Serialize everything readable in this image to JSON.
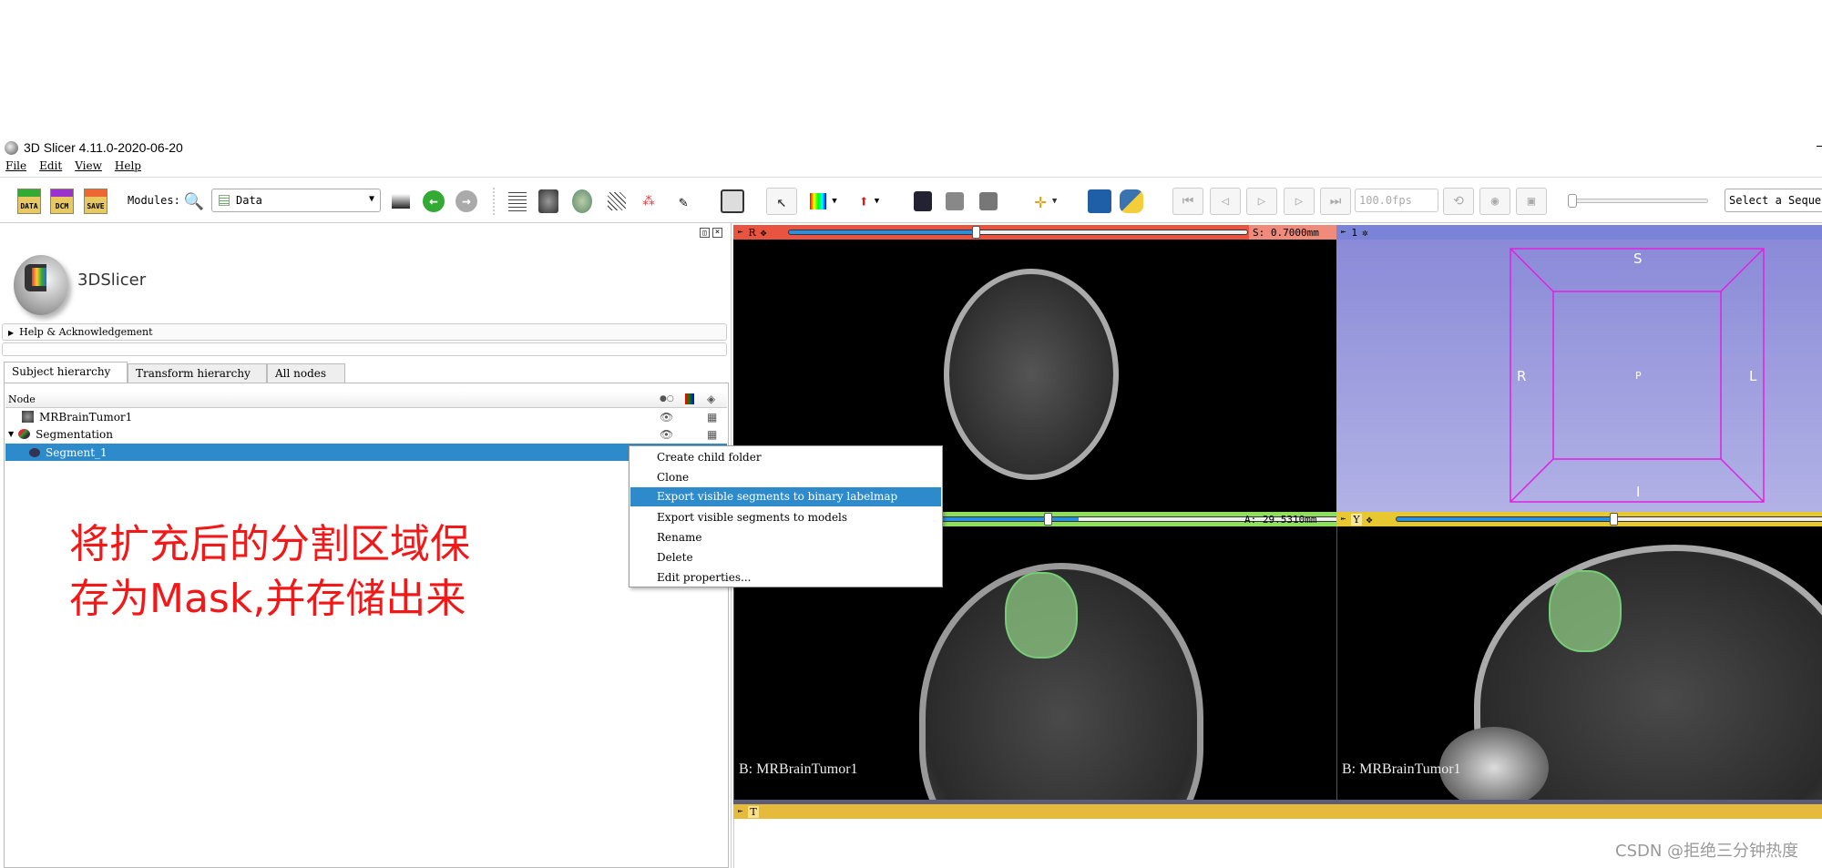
{
  "window": {
    "title": "3D Slicer 4.11.0-2020-06-20"
  },
  "menu": [
    "File",
    "Edit",
    "View",
    "Help"
  ],
  "toolbar": {
    "data_label": "DATA",
    "dcm_label": "DCM",
    "save_label": "SAVE",
    "modules_label": "Modules:",
    "module_selected": "Data",
    "fps": "100.0fps",
    "sequence_placeholder": "Select a Sequence"
  },
  "panel": {
    "logo_text": "3DSlicer",
    "help_section": "Help & Acknowledgement",
    "tabs": [
      "Subject hierarchy",
      "Transform hierarchy",
      "All nodes"
    ],
    "tree_header": "Node",
    "tree": [
      {
        "label": "MRBrainTumor1"
      },
      {
        "label": "Segmentation"
      },
      {
        "label": "Segment_1",
        "selected": true
      }
    ]
  },
  "context_menu": {
    "items": [
      "Create child folder",
      "Clone",
      "Export visible segments to binary labelmap",
      "Export visible segments to models",
      "Rename",
      "Delete",
      "Edit properties..."
    ],
    "highlighted": "Export visible segments to binary labelmap"
  },
  "views": {
    "red": {
      "name": "R",
      "offset": "S: 0.7000mm",
      "slider": 0.4,
      "color": "#e8543f"
    },
    "green": {
      "offset": "A: 29.5310mm",
      "slider": 0.45,
      "color": "#8ee05a",
      "background": "B: MRBrainTumor1"
    },
    "yellow": {
      "name": "Y",
      "slider": 0.55,
      "color": "#e8c830",
      "background": "B: MRBrainTumor1"
    },
    "threed": {
      "name": "1",
      "labels": {
        "S": "S",
        "I": "I",
        "R": "R",
        "L": "L",
        "P": "P"
      },
      "box_color": "#e020e0"
    },
    "table": {
      "name": "T"
    }
  },
  "annotation": {
    "line1": "将扩充后的分割区域保",
    "line2": "存为Mask,并存储出来"
  },
  "watermark": "CSDN @拒绝三分钟热度"
}
